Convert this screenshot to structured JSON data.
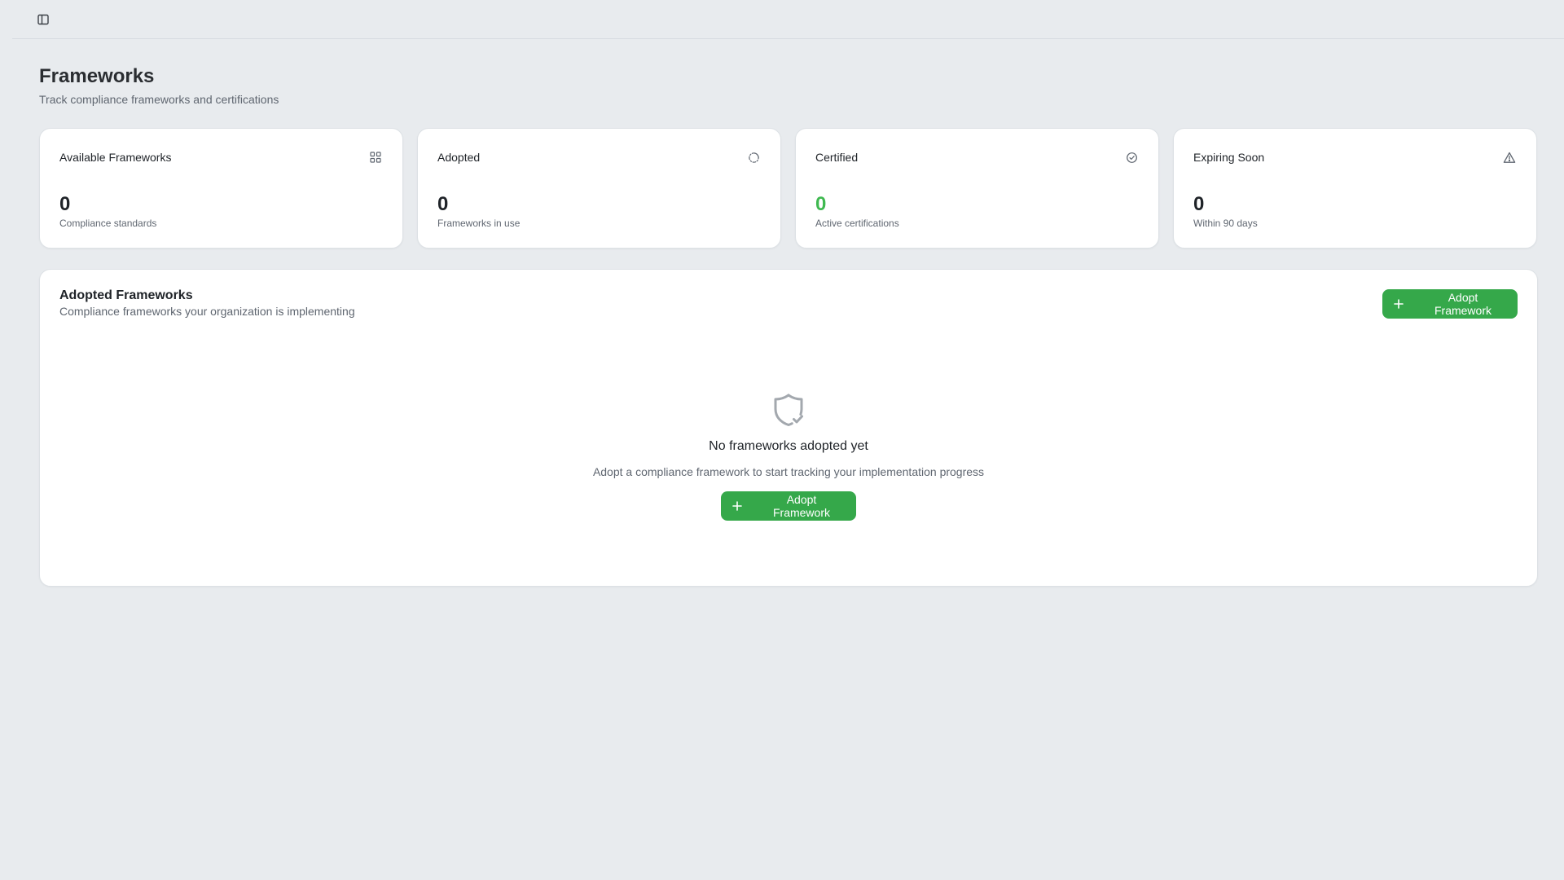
{
  "header": {
    "title": "Frameworks",
    "subtitle": "Track compliance frameworks and certifications"
  },
  "stats": [
    {
      "label": "Available Frameworks",
      "value": "0",
      "caption": "Compliance standards",
      "icon": "grid-icon"
    },
    {
      "label": "Adopted",
      "value": "0",
      "caption": "Frameworks in use",
      "icon": "loader-icon"
    },
    {
      "label": "Certified",
      "value": "0",
      "caption": "Active certifications",
      "icon": "check-circle-icon",
      "value_color": "#3fb950"
    },
    {
      "label": "Expiring Soon",
      "value": "0",
      "caption": "Within 90 days",
      "icon": "warning-triangle-icon"
    }
  ],
  "adopted_panel": {
    "title": "Adopted Frameworks",
    "subtitle": "Compliance frameworks your organization is implementing",
    "adopt_button_label": "Adopt Framework",
    "empty_state": {
      "icon": "shield-check-icon",
      "title": "No frameworks adopted yet",
      "description": "Adopt a compliance framework to start tracking your implementation progress",
      "button_label": "Adopt Framework"
    }
  },
  "colors": {
    "accent": "#35a84a",
    "certified_value": "#3fb950",
    "background": "#e8ebee"
  }
}
